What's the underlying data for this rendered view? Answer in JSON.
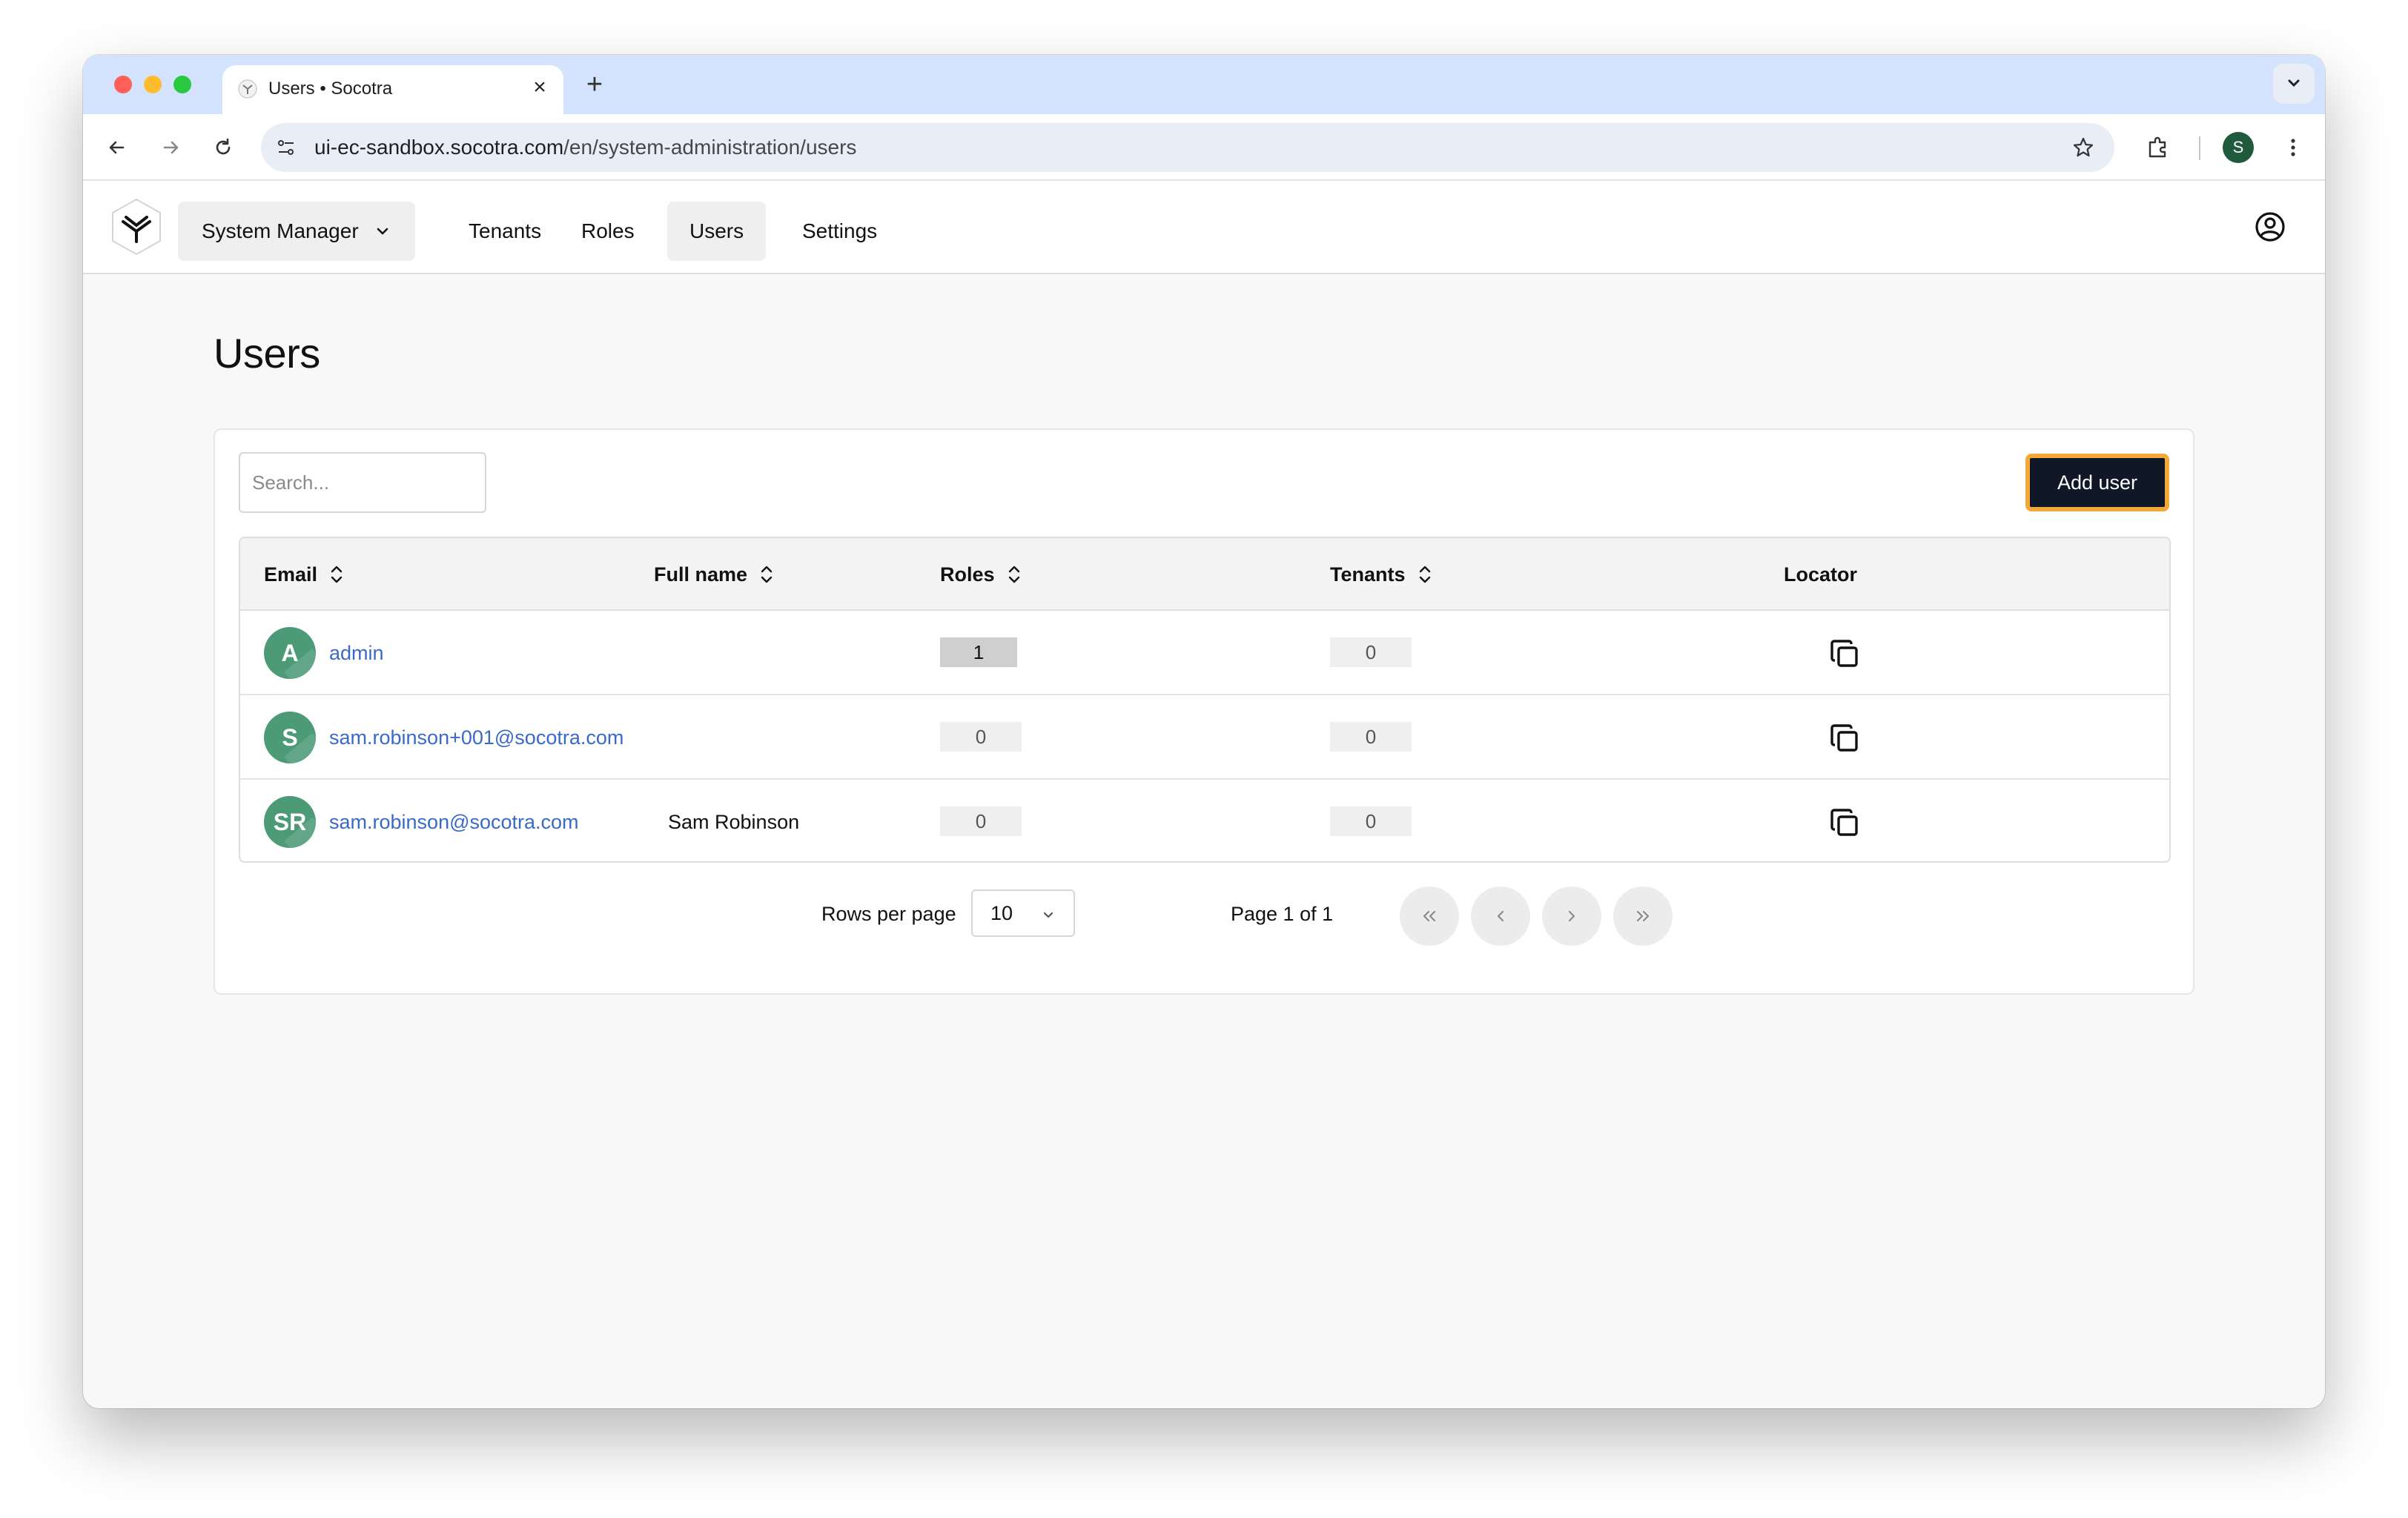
{
  "browser": {
    "tab_title": "Users • Socotra",
    "url_host": "ui-ec-sandbox.socotra.com",
    "url_path": "/en/system-administration/users",
    "profile_initial": "S"
  },
  "header": {
    "workspace_label": "System Manager",
    "nav": [
      "Tenants",
      "Roles",
      "Users",
      "Settings"
    ],
    "active_nav": "Users"
  },
  "page": {
    "title": "Users",
    "search_placeholder": "Search...",
    "add_user_label": "Add user"
  },
  "table": {
    "columns": [
      "Email",
      "Full name",
      "Roles",
      "Tenants",
      "Locator"
    ],
    "rows": [
      {
        "initials": "A",
        "email": "admin",
        "full_name": "",
        "roles": "1",
        "tenants": "0"
      },
      {
        "initials": "S",
        "email": "sam.robinson+001@socotra.com",
        "full_name": "",
        "roles": "0",
        "tenants": "0"
      },
      {
        "initials": "SR",
        "email": "sam.robinson@socotra.com",
        "full_name": "Sam Robinson",
        "roles": "0",
        "tenants": "0"
      }
    ]
  },
  "pagination": {
    "rows_per_page_label": "Rows per page",
    "rows_per_page_value": "10",
    "page_info": "Page 1 of 1"
  },
  "colors": {
    "accent": "#101828",
    "focus_ring": "#f3a83a",
    "avatar": "#4c9a76",
    "link": "#3a6ac8"
  }
}
